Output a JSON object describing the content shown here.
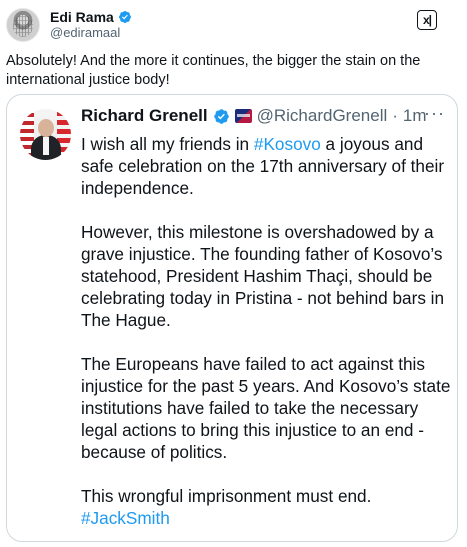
{
  "tweet": {
    "author": {
      "display_name": "Edi Rama",
      "handle": "@ediramaal",
      "verified_icon": "verified-badge-icon",
      "verified_color": "#1d9bf0"
    },
    "xai_button_label": "x|",
    "text": "Absolutely! And the more it continues, the bigger the stain on the international justice body!"
  },
  "quote": {
    "author": {
      "display_name": "Richard Grenell",
      "handle": "@RichardGrenell",
      "separator": "·",
      "time": "1m",
      "verified_icon": "verified-badge-icon",
      "affiliation_icon": "affiliation-badge-icon"
    },
    "more_label": "···",
    "paragraphs": [
      {
        "before": "I wish all my friends in ",
        "hashtag": "#Kosovo",
        "after": " a joyous and safe celebration on the 17th anniversary of their independence."
      },
      {
        "text": "However, this milestone is overshadowed by a grave injustice. The founding father of Kosovo’s statehood, President Hashim Thaçi, should be celebrating today in Pristina - not behind bars in The Hague."
      },
      {
        "text": "The Europeans have failed to act against this injustice for the past 5 years. And Kosovo’s state institutions have failed to take the necessary legal actions to bring this injustice to an end - because of politics."
      },
      {
        "text": "This wrongful imprisonment must end.",
        "hashtag": "#JackSmith"
      }
    ]
  },
  "colors": {
    "link": "#1d9bf0",
    "text": "#0f1419",
    "muted": "#536471",
    "border": "#cfd9de"
  }
}
